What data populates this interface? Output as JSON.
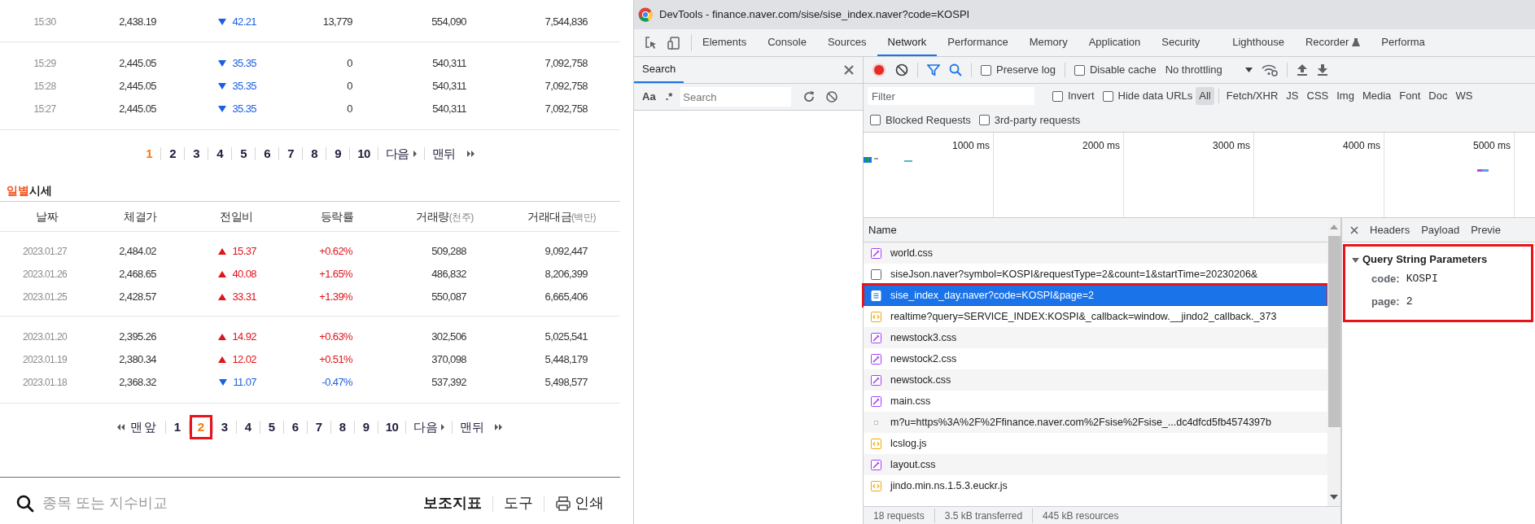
{
  "stock_page": {
    "minute_table": {
      "groups": [
        [
          {
            "time": "15:30",
            "price": "2,438.19",
            "change": {
              "rising": false,
              "value": "42.21"
            },
            "column_4": "13,779",
            "column_5": "554,090",
            "column_6": "7,544,836"
          }
        ],
        [
          {
            "time": "15:29",
            "price": "2,445.05",
            "change": {
              "rising": false,
              "value": "35.35"
            },
            "column_4": "0",
            "column_5": "540,311",
            "column_6": "7,092,758"
          },
          {
            "time": "15:28",
            "price": "2,445.05",
            "change": {
              "rising": false,
              "value": "35.35"
            },
            "column_4": "0",
            "column_5": "540,311",
            "column_6": "7,092,758"
          },
          {
            "time": "15:27",
            "price": "2,445.05",
            "change": {
              "rising": false,
              "value": "35.35"
            },
            "column_4": "0",
            "column_5": "540,311",
            "column_6": "7,092,758"
          }
        ]
      ]
    },
    "minute_pagination": [
      {
        "kind": "page",
        "label": "1",
        "selected": true,
        "highlighted": false
      },
      {
        "kind": "page",
        "label": "2",
        "selected": false,
        "highlighted": false
      },
      {
        "kind": "page",
        "label": "3",
        "selected": false,
        "highlighted": false
      },
      {
        "kind": "page",
        "label": "4",
        "selected": false,
        "highlighted": false
      },
      {
        "kind": "page",
        "label": "5",
        "selected": false,
        "highlighted": false
      },
      {
        "kind": "page",
        "label": "6",
        "selected": false,
        "highlighted": false
      },
      {
        "kind": "page",
        "label": "7",
        "selected": false,
        "highlighted": false
      },
      {
        "kind": "page",
        "label": "8",
        "selected": false,
        "highlighted": false
      },
      {
        "kind": "page",
        "label": "9",
        "selected": false,
        "highlighted": false
      },
      {
        "kind": "page",
        "label": "10",
        "selected": false,
        "highlighted": false
      },
      {
        "kind": "next",
        "label": "다음",
        "selected": false,
        "highlighted": false
      },
      {
        "kind": "last",
        "label": "맨뒤",
        "selected": false,
        "highlighted": false
      }
    ],
    "daily_title": {
      "accent": "일별",
      "rest": "시세"
    },
    "daily_table": {
      "columns": [
        {
          "label": "날짜"
        },
        {
          "label": "체결가"
        },
        {
          "label": "전일비"
        },
        {
          "label": "등락률"
        },
        {
          "label": "거래량",
          "unit": "(천주)"
        },
        {
          "label": "거래대금",
          "unit": "(백만)"
        }
      ],
      "groups": [
        [
          {
            "date": "2023.01.27",
            "close": "2,484.02",
            "change": {
              "rising": true,
              "value": "15.37"
            },
            "rate": "+0.62%",
            "volume": "509,288",
            "amount": "9,092,447"
          },
          {
            "date": "2023.01.26",
            "close": "2,468.65",
            "change": {
              "rising": true,
              "value": "40.08"
            },
            "rate": "+1.65%",
            "volume": "486,832",
            "amount": "8,206,399"
          },
          {
            "date": "2023.01.25",
            "close": "2,428.57",
            "change": {
              "rising": true,
              "value": "33.31"
            },
            "rate": "+1.39%",
            "volume": "550,087",
            "amount": "6,665,406"
          }
        ],
        [
          {
            "date": "2023.01.20",
            "close": "2,395.26",
            "change": {
              "rising": true,
              "value": "14.92"
            },
            "rate": "+0.63%",
            "volume": "302,506",
            "amount": "5,025,541"
          },
          {
            "date": "2023.01.19",
            "close": "2,380.34",
            "change": {
              "rising": true,
              "value": "12.02"
            },
            "rate": "+0.51%",
            "volume": "370,098",
            "amount": "5,448,179"
          },
          {
            "date": "2023.01.18",
            "close": "2,368.32",
            "change": {
              "rising": false,
              "value": "11.07"
            },
            "rate": "-0.47%",
            "volume": "537,392",
            "amount": "5,498,577"
          }
        ]
      ]
    },
    "daily_pagination": [
      {
        "kind": "first",
        "label": "맨앞",
        "selected": false,
        "highlighted": false
      },
      {
        "kind": "page",
        "label": "1",
        "selected": false,
        "highlighted": false
      },
      {
        "kind": "page",
        "label": "2",
        "selected": true,
        "highlighted": true
      },
      {
        "kind": "page",
        "label": "3",
        "selected": false,
        "highlighted": false
      },
      {
        "kind": "page",
        "label": "4",
        "selected": false,
        "highlighted": false
      },
      {
        "kind": "page",
        "label": "5",
        "selected": false,
        "highlighted": false
      },
      {
        "kind": "page",
        "label": "6",
        "selected": false,
        "highlighted": false
      },
      {
        "kind": "page",
        "label": "7",
        "selected": false,
        "highlighted": false
      },
      {
        "kind": "page",
        "label": "8",
        "selected": false,
        "highlighted": false
      },
      {
        "kind": "page",
        "label": "9",
        "selected": false,
        "highlighted": false
      },
      {
        "kind": "page",
        "label": "10",
        "selected": false,
        "highlighted": false
      },
      {
        "kind": "next",
        "label": "다음",
        "selected": false,
        "highlighted": false
      },
      {
        "kind": "last",
        "label": "맨뒤",
        "selected": false,
        "highlighted": false
      }
    ],
    "bottom_bar": {
      "search_placeholder": "종목 또는 지수비교",
      "tools": [
        {
          "kind": "text",
          "label": "보조지표",
          "emphasized": true
        },
        {
          "kind": "text",
          "label": "도구",
          "emphasized": false
        },
        {
          "kind": "print",
          "label": "인쇄",
          "emphasized": false
        }
      ]
    }
  },
  "devtools": {
    "window": {
      "title": "DevTools - finance.naver.com/sise/sise_index.naver?code=KOSPI"
    },
    "tabs": [
      {
        "label": "Elements",
        "selected": false,
        "experimental": false
      },
      {
        "label": "Console",
        "selected": false,
        "experimental": false
      },
      {
        "label": "Sources",
        "selected": false,
        "experimental": false
      },
      {
        "label": "Network",
        "selected": true,
        "experimental": false
      },
      {
        "label": "Performance",
        "selected": false,
        "experimental": false
      },
      {
        "label": "Memory",
        "selected": false,
        "experimental": false
      },
      {
        "label": "Application",
        "selected": false,
        "experimental": false
      },
      {
        "label": "Security",
        "selected": false,
        "experimental": false
      },
      {
        "label": "Lighthouse",
        "selected": false,
        "experimental": false
      },
      {
        "label": "Recorder",
        "selected": false,
        "experimental": true
      },
      {
        "label": "Performa",
        "selected": false,
        "experimental": false
      }
    ],
    "search_panel": {
      "title": "Search",
      "case_toggle": "Aa",
      "regex_toggle": ".*",
      "placeholder": "Search"
    },
    "toolbar": {
      "recording": true,
      "preserve_log": {
        "label": "Preserve log",
        "checked": false
      },
      "disable_cache": {
        "label": "Disable cache",
        "checked": false
      },
      "throttling": "No throttling"
    },
    "filter_bar": {
      "placeholder": "Filter",
      "invert": {
        "label": "Invert",
        "checked": false
      },
      "hide_data_urls": {
        "label": "Hide data URLs",
        "checked": false
      },
      "types": [
        {
          "label": "All",
          "selected": true
        },
        {
          "label": "Fetch/XHR",
          "selected": false
        },
        {
          "label": "JS",
          "selected": false
        },
        {
          "label": "CSS",
          "selected": false
        },
        {
          "label": "Img",
          "selected": false
        },
        {
          "label": "Media",
          "selected": false
        },
        {
          "label": "Font",
          "selected": false
        },
        {
          "label": "Doc",
          "selected": false
        },
        {
          "label": "WS",
          "selected": false
        }
      ],
      "blocked_requests": {
        "label": "Blocked Requests",
        "checked": false
      },
      "third_party": {
        "label": "3rd-party requests",
        "checked": false
      }
    },
    "timeline": {
      "ticks": [
        "1000 ms",
        "2000 ms",
        "3000 ms",
        "4000 ms",
        "5000 ms"
      ]
    },
    "requests": {
      "column": "Name",
      "rows": [
        {
          "name": "world.css",
          "kind": "css",
          "selected": false,
          "highlighted": false
        },
        {
          "name": "siseJson.naver?symbol=KOSPI&requestType=2&count=1&startTime=20230206&",
          "kind": "other",
          "selected": false,
          "highlighted": false
        },
        {
          "name": "sise_index_day.naver?code=KOSPI&page=2",
          "kind": "document",
          "selected": true,
          "highlighted": true
        },
        {
          "name": "realtime?query=SERVICE_INDEX:KOSPI&_callback=window.__jindo2_callback._373",
          "kind": "script",
          "selected": false,
          "highlighted": false
        },
        {
          "name": "newstock3.css",
          "kind": "css",
          "selected": false,
          "highlighted": false
        },
        {
          "name": "newstock2.css",
          "kind": "css",
          "selected": false,
          "highlighted": false
        },
        {
          "name": "newstock.css",
          "kind": "css",
          "selected": false,
          "highlighted": false
        },
        {
          "name": "main.css",
          "kind": "css",
          "selected": false,
          "highlighted": false
        },
        {
          "name": "m?u=https%3A%2F%2Ffinance.naver.com%2Fsise%2Fsise_...dc4dfcd5fb4574397b",
          "kind": "ping",
          "selected": false,
          "highlighted": false
        },
        {
          "name": "lcslog.js",
          "kind": "script",
          "selected": false,
          "highlighted": false
        },
        {
          "name": "layout.css",
          "kind": "css",
          "selected": false,
          "highlighted": false
        },
        {
          "name": "jindo.min.ns.1.5.3.euckr.js",
          "kind": "script",
          "selected": false,
          "highlighted": false
        }
      ]
    },
    "status_bar": [
      "18 requests",
      "3.5 kB transferred",
      "445 kB resources"
    ],
    "details": {
      "tabs": [
        "Headers",
        "Payload",
        "Previe"
      ],
      "query": {
        "title": "Query String Parameters",
        "expanded": true,
        "highlighted": true,
        "params": [
          {
            "key": "code:",
            "value": "KOSPI"
          },
          {
            "key": "page:",
            "value": "2"
          }
        ]
      }
    }
  }
}
